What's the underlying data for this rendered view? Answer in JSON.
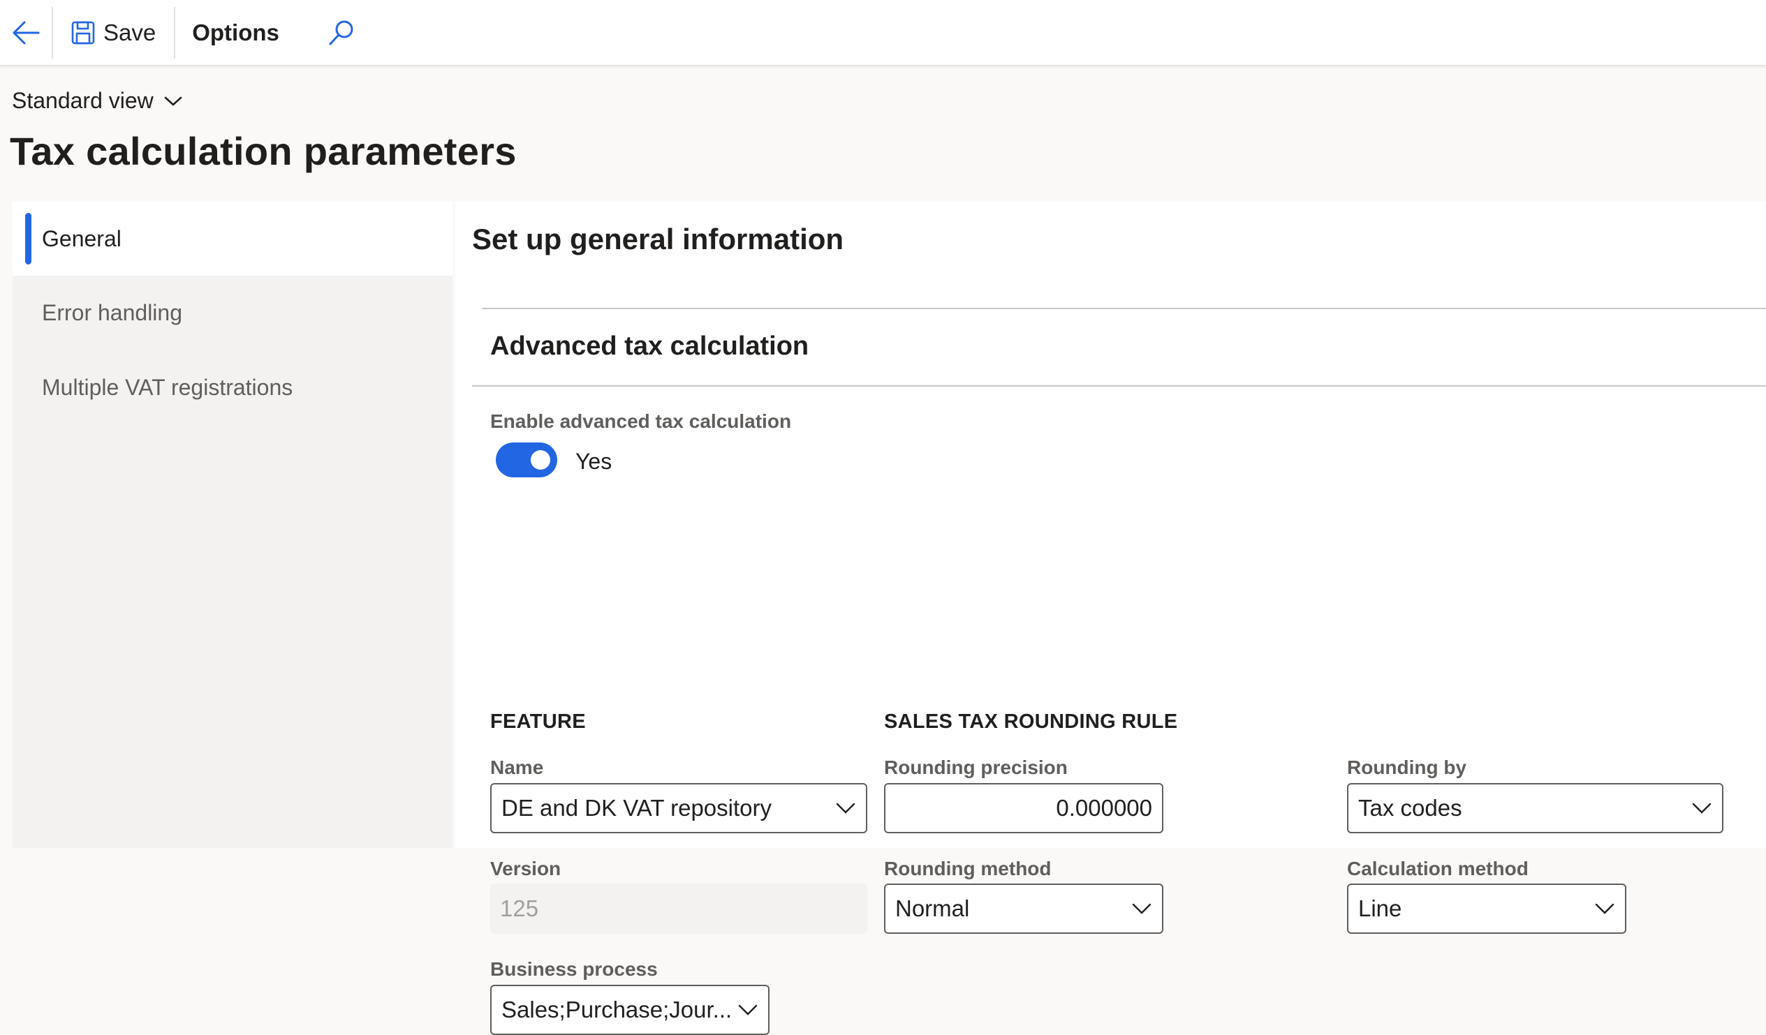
{
  "toolbar": {
    "save_label": "Save",
    "options_label": "Options"
  },
  "header": {
    "view_label": "Standard view",
    "page_title": "Tax calculation parameters"
  },
  "nav": {
    "items": [
      {
        "label": "General",
        "active": true
      },
      {
        "label": "Error handling",
        "active": false
      },
      {
        "label": "Multiple VAT registrations",
        "active": false
      }
    ]
  },
  "main": {
    "section_title": "Set up general information",
    "subsection_title": "Advanced tax calculation",
    "enable": {
      "label": "Enable advanced tax calculation",
      "value": "Yes"
    },
    "feature": {
      "header": "FEATURE",
      "name_label": "Name",
      "name_value": "DE and DK VAT repository",
      "version_label": "Version",
      "version_value": "125",
      "business_process_label": "Business process",
      "business_process_value": "Sales;Purchase;Jour..."
    },
    "rounding": {
      "header": "SALES TAX ROUNDING RULE",
      "precision_label": "Rounding precision",
      "precision_value": "0.000000",
      "method_label": "Rounding method",
      "method_value": "Normal",
      "by_label": "Rounding by",
      "by_value": "Tax codes",
      "calc_method_label": "Calculation method",
      "calc_method_value": "Line"
    }
  },
  "colors": {
    "accent": "#2266e3",
    "text": "#201f1e",
    "muted": "#605e5c",
    "page_bg": "#faf9f8"
  }
}
